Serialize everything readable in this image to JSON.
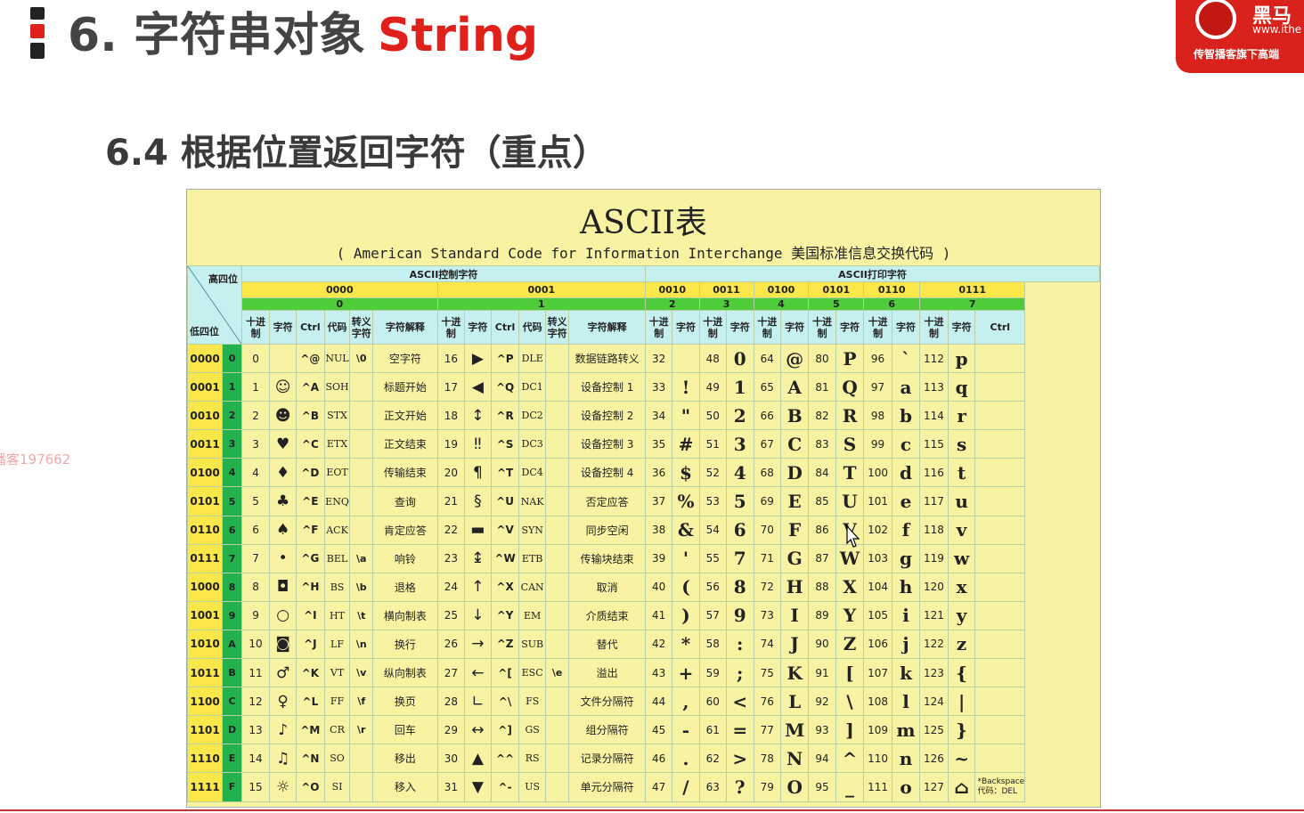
{
  "header": {
    "title_cn": "6. 字符串对象",
    "title_en": "String",
    "subtitle": "6.4 根据位置返回字符（重点）"
  },
  "logo": {
    "name": "黑马",
    "url": "www.ithe",
    "slogan": "传智播客旗下高端",
    "color": "#d8221b"
  },
  "watermark": "播客197662",
  "ascii": {
    "title": "ASCII表",
    "subtitle": "( American Standard Code for Information Interchange 美国标准信息交换代码 )",
    "corner_top": "高四位",
    "corner_bottom": "低四位",
    "group_control": "ASCII控制字符",
    "group_print": "ASCII打印字符",
    "high_bits": [
      "0000",
      "0001",
      "0010",
      "0011",
      "0100",
      "0101",
      "0110",
      "0111"
    ],
    "high_hex": [
      "0",
      "1",
      "2",
      "3",
      "4",
      "5",
      "6",
      "7"
    ],
    "col_headers": {
      "dec": "十进制",
      "chr": "字符",
      "ctrl": "Ctrl",
      "code": "代码",
      "esc": "转义字符",
      "desc": "字符解释"
    },
    "rows": [
      {
        "bin": "0000",
        "hex": "0",
        "c0": [
          "0",
          "",
          "^@",
          "NUL",
          "\\0",
          "空字符"
        ],
        "c1": [
          "16",
          "▶",
          "^P",
          "DLE",
          "",
          "数据链路转义"
        ],
        "p": [
          [
            "32",
            " "
          ],
          [
            "48",
            "0"
          ],
          [
            "64",
            "@"
          ],
          [
            "80",
            "P"
          ],
          [
            "96",
            "`"
          ],
          [
            "112",
            "p"
          ]
        ]
      },
      {
        "bin": "0001",
        "hex": "1",
        "c0": [
          "1",
          "☺",
          "^A",
          "SOH",
          "",
          "标题开始"
        ],
        "c1": [
          "17",
          "◀",
          "^Q",
          "DC1",
          "",
          "设备控制 1"
        ],
        "p": [
          [
            "33",
            "!"
          ],
          [
            "49",
            "1"
          ],
          [
            "65",
            "A"
          ],
          [
            "81",
            "Q"
          ],
          [
            "97",
            "a"
          ],
          [
            "113",
            "q"
          ]
        ]
      },
      {
        "bin": "0010",
        "hex": "2",
        "c0": [
          "2",
          "☻",
          "^B",
          "STX",
          "",
          "正文开始"
        ],
        "c1": [
          "18",
          "↕",
          "^R",
          "DC2",
          "",
          "设备控制 2"
        ],
        "p": [
          [
            "34",
            "\""
          ],
          [
            "50",
            "2"
          ],
          [
            "66",
            "B"
          ],
          [
            "82",
            "R"
          ],
          [
            "98",
            "b"
          ],
          [
            "114",
            "r"
          ]
        ]
      },
      {
        "bin": "0011",
        "hex": "3",
        "c0": [
          "3",
          "♥",
          "^C",
          "ETX",
          "",
          "正文结束"
        ],
        "c1": [
          "19",
          "‼",
          "^S",
          "DC3",
          "",
          "设备控制 3"
        ],
        "p": [
          [
            "35",
            "#"
          ],
          [
            "51",
            "3"
          ],
          [
            "67",
            "C"
          ],
          [
            "83",
            "S"
          ],
          [
            "99",
            "c"
          ],
          [
            "115",
            "s"
          ]
        ]
      },
      {
        "bin": "0100",
        "hex": "4",
        "c0": [
          "4",
          "♦",
          "^D",
          "EOT",
          "",
          "传输结束"
        ],
        "c1": [
          "20",
          "¶",
          "^T",
          "DC4",
          "",
          "设备控制 4"
        ],
        "p": [
          [
            "36",
            "$"
          ],
          [
            "52",
            "4"
          ],
          [
            "68",
            "D"
          ],
          [
            "84",
            "T"
          ],
          [
            "100",
            "d"
          ],
          [
            "116",
            "t"
          ]
        ]
      },
      {
        "bin": "0101",
        "hex": "5",
        "c0": [
          "5",
          "♣",
          "^E",
          "ENQ",
          "",
          "查询"
        ],
        "c1": [
          "21",
          "§",
          "^U",
          "NAK",
          "",
          "否定应答"
        ],
        "p": [
          [
            "37",
            "%"
          ],
          [
            "53",
            "5"
          ],
          [
            "69",
            "E"
          ],
          [
            "85",
            "U"
          ],
          [
            "101",
            "e"
          ],
          [
            "117",
            "u"
          ]
        ]
      },
      {
        "bin": "0110",
        "hex": "6",
        "c0": [
          "6",
          "♠",
          "^F",
          "ACK",
          "",
          "肯定应答"
        ],
        "c1": [
          "22",
          "▬",
          "^V",
          "SYN",
          "",
          "同步空闲"
        ],
        "p": [
          [
            "38",
            "&"
          ],
          [
            "54",
            "6"
          ],
          [
            "70",
            "F"
          ],
          [
            "86",
            "V"
          ],
          [
            "102",
            "f"
          ],
          [
            "118",
            "v"
          ]
        ]
      },
      {
        "bin": "0111",
        "hex": "7",
        "c0": [
          "7",
          "•",
          "^G",
          "BEL",
          "\\a",
          "响铃"
        ],
        "c1": [
          "23",
          "↨",
          "^W",
          "ETB",
          "",
          "传输块结束"
        ],
        "p": [
          [
            "39",
            "'"
          ],
          [
            "55",
            "7"
          ],
          [
            "71",
            "G"
          ],
          [
            "87",
            "W"
          ],
          [
            "103",
            "g"
          ],
          [
            "119",
            "w"
          ]
        ]
      },
      {
        "bin": "1000",
        "hex": "8",
        "c0": [
          "8",
          "◘",
          "^H",
          "BS",
          "\\b",
          "退格"
        ],
        "c1": [
          "24",
          "↑",
          "^X",
          "CAN",
          "",
          "取消"
        ],
        "p": [
          [
            "40",
            "("
          ],
          [
            "56",
            "8"
          ],
          [
            "72",
            "H"
          ],
          [
            "88",
            "X"
          ],
          [
            "104",
            "h"
          ],
          [
            "120",
            "x"
          ]
        ]
      },
      {
        "bin": "1001",
        "hex": "9",
        "c0": [
          "9",
          "○",
          "^I",
          "HT",
          "\\t",
          "横向制表"
        ],
        "c1": [
          "25",
          "↓",
          "^Y",
          "EM",
          "",
          "介质结束"
        ],
        "p": [
          [
            "41",
            ")"
          ],
          [
            "57",
            "9"
          ],
          [
            "73",
            "I"
          ],
          [
            "89",
            "Y"
          ],
          [
            "105",
            "i"
          ],
          [
            "121",
            "y"
          ]
        ]
      },
      {
        "bin": "1010",
        "hex": "A",
        "c0": [
          "10",
          "◙",
          "^J",
          "LF",
          "\\n",
          "换行"
        ],
        "c1": [
          "26",
          "→",
          "^Z",
          "SUB",
          "",
          "替代"
        ],
        "p": [
          [
            "42",
            "*"
          ],
          [
            "58",
            ":"
          ],
          [
            "74",
            "J"
          ],
          [
            "90",
            "Z"
          ],
          [
            "106",
            "j"
          ],
          [
            "122",
            "z"
          ]
        ]
      },
      {
        "bin": "1011",
        "hex": "B",
        "c0": [
          "11",
          "♂",
          "^K",
          "VT",
          "\\v",
          "纵向制表"
        ],
        "c1": [
          "27",
          "←",
          "^[",
          "ESC",
          "\\e",
          "溢出"
        ],
        "p": [
          [
            "43",
            "+"
          ],
          [
            "59",
            ";"
          ],
          [
            "75",
            "K"
          ],
          [
            "91",
            "["
          ],
          [
            "107",
            "k"
          ],
          [
            "123",
            "{"
          ]
        ]
      },
      {
        "bin": "1100",
        "hex": "C",
        "c0": [
          "12",
          "♀",
          "^L",
          "FF",
          "\\f",
          "换页"
        ],
        "c1": [
          "28",
          "∟",
          "^\\",
          "FS",
          "",
          "文件分隔符"
        ],
        "p": [
          [
            "44",
            ","
          ],
          [
            "60",
            "<"
          ],
          [
            "76",
            "L"
          ],
          [
            "92",
            "\\"
          ],
          [
            "108",
            "l"
          ],
          [
            "124",
            "|"
          ]
        ]
      },
      {
        "bin": "1101",
        "hex": "D",
        "c0": [
          "13",
          "♪",
          "^M",
          "CR",
          "\\r",
          "回车"
        ],
        "c1": [
          "29",
          "↔",
          "^]",
          "GS",
          "",
          "组分隔符"
        ],
        "p": [
          [
            "45",
            "-"
          ],
          [
            "61",
            "="
          ],
          [
            "77",
            "M"
          ],
          [
            "93",
            "]"
          ],
          [
            "109",
            "m"
          ],
          [
            "125",
            "}"
          ]
        ]
      },
      {
        "bin": "1110",
        "hex": "E",
        "c0": [
          "14",
          "♫",
          "^N",
          "SO",
          "",
          "移出"
        ],
        "c1": [
          "30",
          "▲",
          "^^",
          "RS",
          "",
          "记录分隔符"
        ],
        "p": [
          [
            "46",
            "."
          ],
          [
            "62",
            ">"
          ],
          [
            "78",
            "N"
          ],
          [
            "94",
            "^"
          ],
          [
            "110",
            "n"
          ],
          [
            "126",
            "~"
          ]
        ]
      },
      {
        "bin": "1111",
        "hex": "F",
        "c0": [
          "15",
          "☼",
          "^O",
          "SI",
          "",
          "移入"
        ],
        "c1": [
          "31",
          "▼",
          "^-",
          "US",
          "",
          "单元分隔符"
        ],
        "p": [
          [
            "47",
            "/"
          ],
          [
            "63",
            "?"
          ],
          [
            "79",
            "O"
          ],
          [
            "95",
            "_"
          ],
          [
            "111",
            "o"
          ],
          [
            "127",
            "⌂"
          ]
        ]
      }
    ],
    "last_ctrl_note": "*Backspace 代码：DEL"
  }
}
